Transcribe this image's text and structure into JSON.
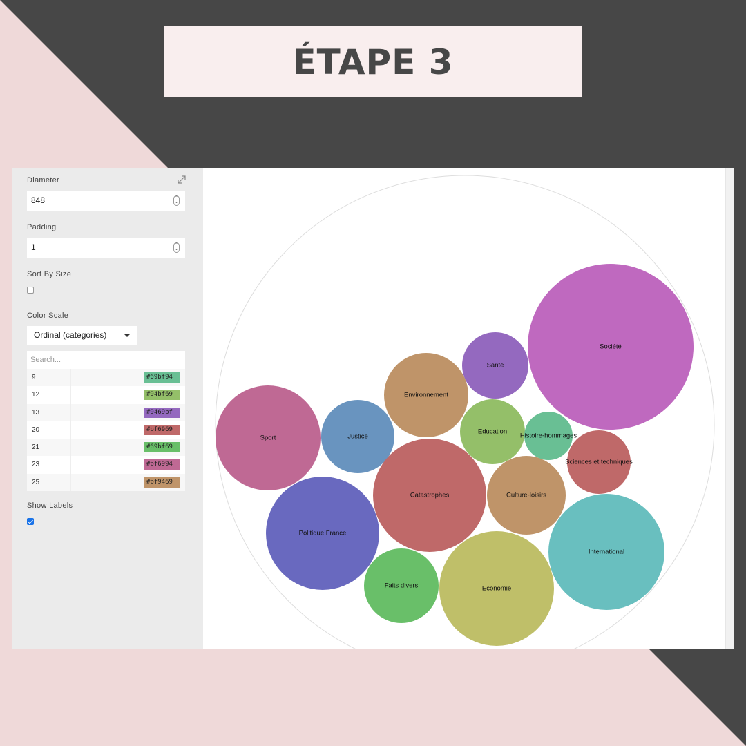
{
  "banner": {
    "title": "ÉTAPE 3"
  },
  "sidebar": {
    "diameter": {
      "label": "Diameter",
      "value": "848"
    },
    "padding": {
      "label": "Padding",
      "value": "1"
    },
    "sort_by_size": {
      "label": "Sort By Size",
      "checked": false
    },
    "color_scale": {
      "label": "Color Scale",
      "selected": "Ordinal (categories)",
      "search_placeholder": "Search...",
      "items": [
        {
          "label": "9",
          "color": "#69bf94"
        },
        {
          "label": "12",
          "color": "#94bf69"
        },
        {
          "label": "13",
          "color": "#9469bf"
        },
        {
          "label": "20",
          "color": "#bf6969"
        },
        {
          "label": "21",
          "color": "#69bf69"
        },
        {
          "label": "23",
          "color": "#bf6994"
        },
        {
          "label": "25",
          "color": "#bf9469"
        }
      ]
    },
    "show_labels": {
      "label": "Show Labels",
      "checked": true
    }
  },
  "bubbles": [
    {
      "label": "Société",
      "color": "#bf69bf",
      "r": 120
    },
    {
      "label": "Santé",
      "color": "#9469bf",
      "r": 48
    },
    {
      "label": "Environnement",
      "color": "#bf9469",
      "r": 61
    },
    {
      "label": "Sport",
      "color": "#bf6994",
      "r": 76
    },
    {
      "label": "Justice",
      "color": "#6994bf",
      "r": 53
    },
    {
      "label": "Education",
      "color": "#94bf69",
      "r": 47
    },
    {
      "label": "Histoire-hommages",
      "color": "#69bf94",
      "r": 35
    },
    {
      "label": "Sciences et techniques",
      "color": "#bf6969",
      "r": 46
    },
    {
      "label": "Catastrophes",
      "color": "#bf6969",
      "r": 82
    },
    {
      "label": "Culture-loisirs",
      "color": "#bf9469",
      "r": 57
    },
    {
      "label": "Politique France",
      "color": "#6969bf",
      "r": 82
    },
    {
      "label": "International",
      "color": "#69bfbf",
      "r": 84
    },
    {
      "label": "Faits divers",
      "color": "#69bf69",
      "r": 54
    },
    {
      "label": "Economie",
      "color": "#bfbf69",
      "r": 83
    }
  ],
  "theme": {
    "dark": "#474747",
    "pink": "#efd9d9",
    "banner_bg": "#f9eeee"
  }
}
